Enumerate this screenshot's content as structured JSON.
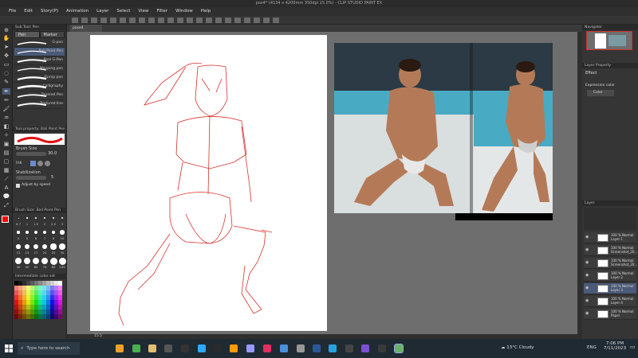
{
  "window": {
    "title": "pos4* (4134 x 4200mm 350dpi 15.0%) - CLIP STUDIO PAINT EX"
  },
  "menu": [
    "File",
    "Edit",
    "Story(P)",
    "Animation",
    "Layer",
    "Select",
    "View",
    "Filter",
    "Window",
    "Help"
  ],
  "document_tab": "pose4",
  "subtool": {
    "panel_title": "Sub Tool: Pen",
    "tabs": [
      "Pen",
      "Marker"
    ],
    "brushes": [
      "G-pen",
      "Real G-Pen",
      "Mapping pen",
      "Turnip pen",
      "Calligraphy",
      "Tapered Pen",
      "Textured line"
    ],
    "selected_brush_label": "Ball Point Pen"
  },
  "tool_property": {
    "title": "Tool property: Ball Point Pen",
    "brush_size_label": "Brush Size",
    "brush_size_value": "30.0",
    "ink_label": "Ink",
    "stabilization_label": "Stabilization",
    "stabilization_value": "5",
    "adjust_by_speed": "Adjust by speed"
  },
  "brush_size_panel": {
    "title": "Brush Size: Ball Point Pen",
    "sizes": [
      "0.7",
      "1",
      "1.5",
      "2",
      "2.5",
      "3",
      "4",
      "5",
      "6",
      "7",
      "8",
      "10",
      "12",
      "15",
      "17",
      "20",
      "25",
      "30",
      "40",
      "50",
      "60",
      "70",
      "80",
      "100"
    ]
  },
  "color_panel": {
    "title": "Intermediate color set",
    "current": "#ff0000"
  },
  "status": {
    "zoom": "15.5"
  },
  "right_panel": {
    "navigator": "Navigator",
    "layer_property_title": "Layer Property",
    "effect_label": "Effect",
    "expression_color_label": "Expression color",
    "expression_color_value": "Color",
    "layer_title": "Layer",
    "layers": [
      {
        "line1": "100 % Normal",
        "line2": "Layer 1"
      },
      {
        "line1": "100 % Normal",
        "line2": "Screenshot_20..."
      },
      {
        "line1": "100 % Normal",
        "line2": "Screenshot_20..."
      },
      {
        "line1": "100 % Normal",
        "line2": "Layer 2"
      },
      {
        "line1": "100 % Normal",
        "line2": "Layer 3"
      },
      {
        "line1": "100 % Normal",
        "line2": "Layer 4"
      },
      {
        "line1": "100 % Normal",
        "line2": "Paper"
      }
    ]
  },
  "taskbar": {
    "search": "Type here to search",
    "weather": "13°C  Cloudy",
    "lang": "ENG",
    "time": "7:06 PM",
    "date": "7/11/2023"
  }
}
